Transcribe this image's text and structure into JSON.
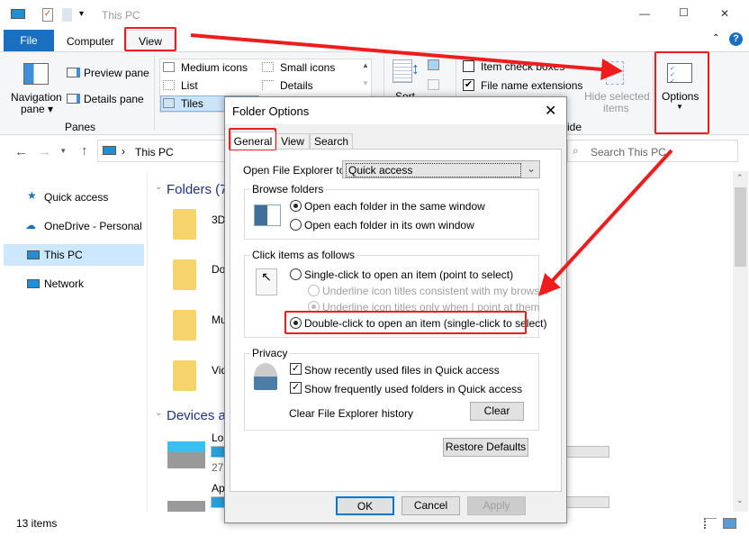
{
  "window": {
    "title": "This PC",
    "min": "—",
    "max": "☐",
    "close": "✕"
  },
  "ribbon_tabs": [
    {
      "label": "File"
    },
    {
      "label": "Computer"
    },
    {
      "label": "View"
    }
  ],
  "ribbon": {
    "panes": {
      "nav_pane": "Navigation",
      "nav_pane2": "pane ▾",
      "preview": "Preview pane",
      "details": "Details pane",
      "group": "Panes"
    },
    "layout": {
      "medium": "Medium icons",
      "small": "Small icons",
      "list": "List",
      "details": "Details",
      "tiles": "Tiles"
    },
    "sort": "Sort",
    "showhide": {
      "item_check": "Item check boxes",
      "file_ext": "File name extensions",
      "hide_selected": "Hide selected",
      "hide_selected2": "items",
      "group": "ide"
    },
    "options": "Options"
  },
  "address": {
    "path": "This PC",
    "search_placeholder": "Search This PC"
  },
  "nav": [
    {
      "label": "Quick access"
    },
    {
      "label": "OneDrive - Personal"
    },
    {
      "label": "This PC"
    },
    {
      "label": "Network"
    }
  ],
  "content": {
    "folders_header": "Folders (7",
    "devices_header": "Devices a",
    "folders": [
      "3D",
      "Do",
      "Mu",
      "Vid"
    ],
    "drives": [
      {
        "name": "Lo",
        "size": "27"
      },
      {
        "name": "Ap",
        "size": "2"
      }
    ]
  },
  "status": {
    "items": "13 items"
  },
  "dialog": {
    "title": "Folder Options",
    "tabs": [
      {
        "label": "General"
      },
      {
        "label": "View"
      },
      {
        "label": "Search"
      }
    ],
    "open_to_label": "Open File Explorer to:",
    "open_to_value": "Quick access",
    "browse": {
      "label": "Browse folders",
      "same": "Open each folder in the same window",
      "own": "Open each folder in its own window",
      "selected": "same"
    },
    "click": {
      "label": "Click items as follows",
      "single": "Single-click to open an item (point to select)",
      "underline_browser": "Underline icon titles consistent with my browser",
      "underline_point": "Underline icon titles only when I point at them",
      "double": "Double-click to open an item (single-click to select)",
      "selected": "double"
    },
    "privacy": {
      "label": "Privacy",
      "recent": "Show recently used files in Quick access",
      "frequent": "Show frequently used folders in Quick access",
      "recent_checked": true,
      "frequent_checked": true,
      "clear_label": "Clear File Explorer history",
      "clear_btn": "Clear"
    },
    "restore": "Restore Defaults",
    "ok": "OK",
    "cancel": "Cancel",
    "apply": "Apply"
  },
  "colors": {
    "accent": "#1a6fc1",
    "highlight": "#ee1c1c"
  }
}
